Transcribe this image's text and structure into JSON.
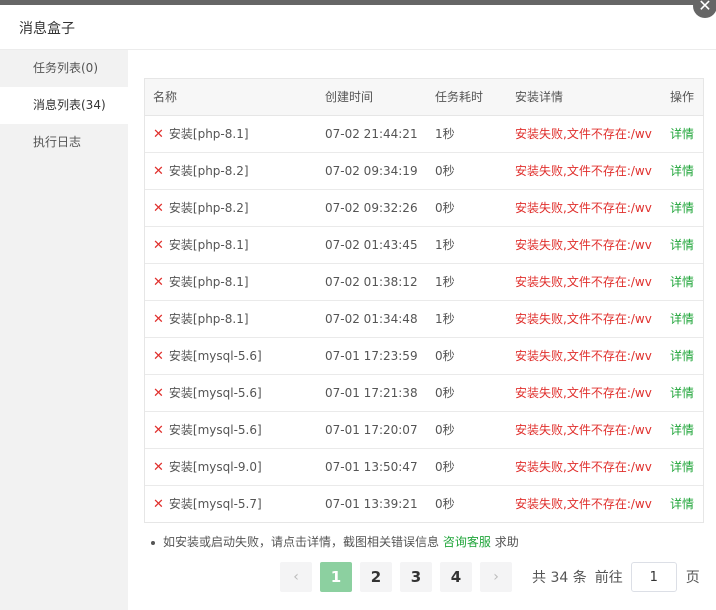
{
  "window": {
    "title": "消息盒子",
    "close_glyph": "✕"
  },
  "sidebar": {
    "items": [
      {
        "label": "任务列表(0)"
      },
      {
        "label": "消息列表(34)"
      },
      {
        "label": "执行日志"
      }
    ],
    "active_index": 1
  },
  "table": {
    "headers": [
      "名称",
      "创建时间",
      "任务耗时",
      "安装详情",
      "操作"
    ],
    "rows": [
      {
        "name": "安装[php-8.1]",
        "time": "07-02 21:44:21",
        "duration": "1秒",
        "detail": "安装失败,文件不存在:/wv",
        "action": "详情"
      },
      {
        "name": "安装[php-8.2]",
        "time": "07-02 09:34:19",
        "duration": "0秒",
        "detail": "安装失败,文件不存在:/wv",
        "action": "详情"
      },
      {
        "name": "安装[php-8.2]",
        "time": "07-02 09:32:26",
        "duration": "0秒",
        "detail": "安装失败,文件不存在:/wv",
        "action": "详情"
      },
      {
        "name": "安装[php-8.1]",
        "time": "07-02 01:43:45",
        "duration": "1秒",
        "detail": "安装失败,文件不存在:/wv",
        "action": "详情"
      },
      {
        "name": "安装[php-8.1]",
        "time": "07-02 01:38:12",
        "duration": "1秒",
        "detail": "安装失败,文件不存在:/wv",
        "action": "详情"
      },
      {
        "name": "安装[php-8.1]",
        "time": "07-02 01:34:48",
        "duration": "1秒",
        "detail": "安装失败,文件不存在:/wv",
        "action": "详情"
      },
      {
        "name": "安装[mysql-5.6]",
        "time": "07-01 17:23:59",
        "duration": "0秒",
        "detail": "安装失败,文件不存在:/wv",
        "action": "详情"
      },
      {
        "name": "安装[mysql-5.6]",
        "time": "07-01 17:21:38",
        "duration": "0秒",
        "detail": "安装失败,文件不存在:/wv",
        "action": "详情"
      },
      {
        "name": "安装[mysql-5.6]",
        "time": "07-01 17:20:07",
        "duration": "0秒",
        "detail": "安装失败,文件不存在:/wv",
        "action": "详情"
      },
      {
        "name": "安装[mysql-9.0]",
        "time": "07-01 13:50:47",
        "duration": "0秒",
        "detail": "安装失败,文件不存在:/wv",
        "action": "详情"
      },
      {
        "name": "安装[mysql-5.7]",
        "time": "07-01 13:39:21",
        "duration": "0秒",
        "detail": "安装失败,文件不存在:/wv",
        "action": "详情"
      }
    ]
  },
  "tip": {
    "prefix": "如安装或启动失败，请点击详情，截图相关错误信息",
    "link": "咨询客服",
    "suffix": "求助"
  },
  "pagination": {
    "prev_glyph": "‹",
    "next_glyph": "›",
    "pages": [
      "1",
      "2",
      "3",
      "4"
    ],
    "current_page": "1",
    "total_text": "共 34 条",
    "goto_label": "前往",
    "goto_value": "1",
    "goto_unit": "页"
  },
  "colors": {
    "error": "#e0302d",
    "link": "#20a53a",
    "page_current": "#8cd0a0"
  }
}
